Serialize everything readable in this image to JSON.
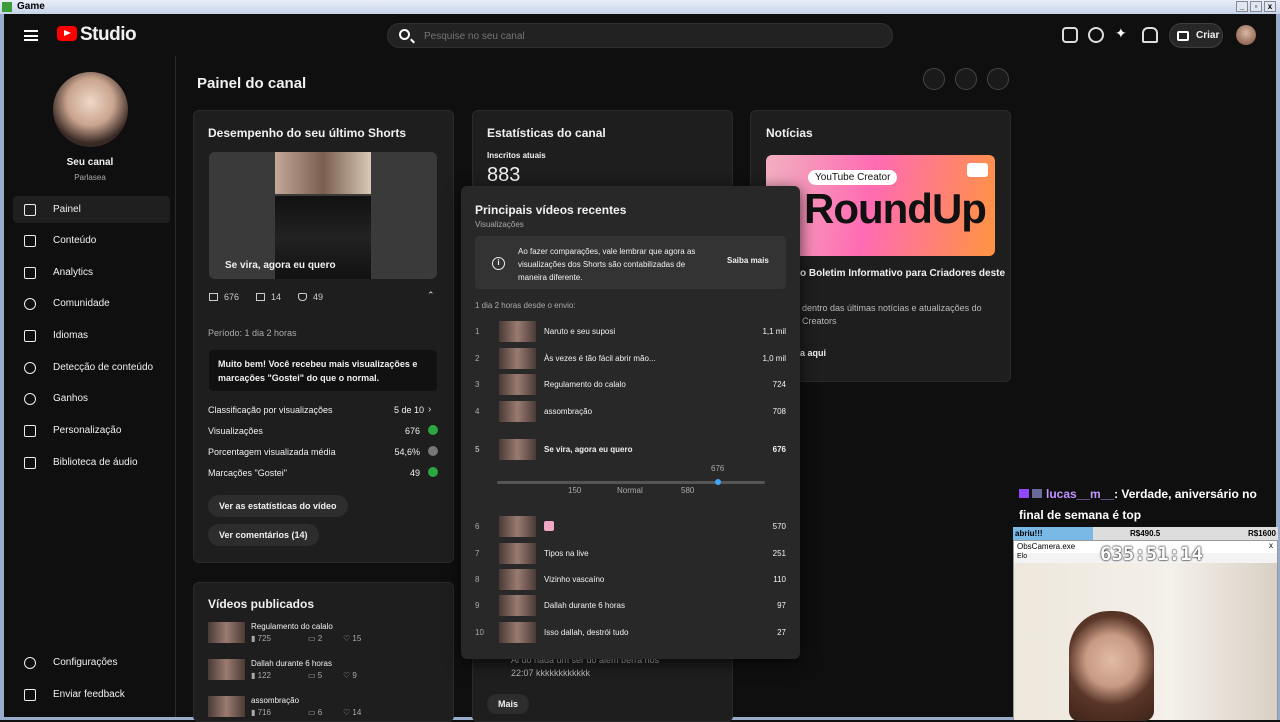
{
  "window": {
    "title": "Game"
  },
  "header": {
    "app": "Studio",
    "search_placeholder": "Pesquise no seu canal",
    "create": "Criar"
  },
  "sidebar": {
    "channel_name": "Seu canal",
    "channel_handle": "Parlasea",
    "items": [
      {
        "label": "Painel"
      },
      {
        "label": "Conteúdo"
      },
      {
        "label": "Analytics"
      },
      {
        "label": "Comunidade"
      },
      {
        "label": "Idiomas"
      },
      {
        "label": "Detecção de conteúdo"
      },
      {
        "label": "Ganhos"
      },
      {
        "label": "Personalização"
      },
      {
        "label": "Biblioteca de áudio"
      }
    ],
    "bottom": [
      {
        "label": "Configurações"
      },
      {
        "label": "Enviar feedback"
      }
    ]
  },
  "main": {
    "title": "Painel do canal"
  },
  "shorts_card": {
    "title": "Desempenho do seu último Shorts",
    "video_title": "Se vira, agora eu quero",
    "stats": {
      "views": "676",
      "comments": "14",
      "likes": "49"
    },
    "period": "Período: 1 dia 2 horas",
    "note": "Muito bem! Você recebeu mais visualizações e marcações \"Gostei\" do que o normal.",
    "metrics": [
      {
        "label": "Classificação por visualizações",
        "value": "5 de 10"
      },
      {
        "label": "Visualizações",
        "value": "676"
      },
      {
        "label": "Porcentagem visualizada média",
        "value": "54,6%"
      },
      {
        "label": "Marcações \"Gostei\"",
        "value": "49"
      }
    ],
    "btn_stats": "Ver as estatísticas do vídeo",
    "btn_comments": "Ver comentários (14)"
  },
  "published": {
    "title": "Vídeos publicados",
    "items": [
      {
        "title": "Regulamento do calalo",
        "views": "725",
        "comments": "2",
        "likes": "15"
      },
      {
        "title": "Dallah durante 6 horas",
        "views": "122",
        "comments": "5",
        "likes": "9"
      },
      {
        "title": "assombração",
        "views": "716",
        "comments": "6",
        "likes": "14"
      }
    ]
  },
  "stats_card": {
    "title": "Estatísticas do canal",
    "subs_label": "Inscritos atuais",
    "subs": "883",
    "comment_text": "Ai do nada um ser do alem berra nos",
    "comment_time": "22:07 kkkkkkkkkkkk",
    "more": "Mais"
  },
  "news": {
    "title": "Notícias",
    "banner_tag": "YouTube Creator",
    "banner_big": "RoundUp",
    "headline": "o Boletim Informativo para Criadores deste",
    "desc1": "dentro das últimas notícias e atualizações do",
    "desc2": "Creators",
    "link": "a aqui"
  },
  "popup": {
    "title": "Principais vídeos recentes",
    "subtitle": "Visualizações",
    "info": "Ao fazer comparações, vale lembrar que agora as visualizações dos Shorts são contabilizadas de maneira diferente.",
    "learn": "Saiba mais",
    "since": "1 dia 2 horas desde o envio:",
    "rows": [
      {
        "rank": "1",
        "title": "Naruto e seu suposi",
        "value": "1,1 mil"
      },
      {
        "rank": "2",
        "title": "Às vezes é tão fácil abrir mão...",
        "value": "1,0 mil"
      },
      {
        "rank": "3",
        "title": "Regulamento do calalo",
        "value": "724"
      },
      {
        "rank": "4",
        "title": "assombração",
        "value": "708"
      },
      {
        "rank": "5",
        "title": "Se vira, agora eu quero",
        "value": "676"
      },
      {
        "rank": "6",
        "title": "",
        "value": "570"
      },
      {
        "rank": "7",
        "title": "Tipos na live",
        "value": "251"
      },
      {
        "rank": "8",
        "title": "Vizinho vascaíno",
        "value": "110"
      },
      {
        "rank": "9",
        "title": "Dallah durante 6 horas",
        "value": "97"
      },
      {
        "rank": "10",
        "title": "Isso dallah, destrói tudo",
        "value": "27"
      }
    ],
    "scale": {
      "current": "676",
      "low": "150",
      "mid": "Normal",
      "high": "580"
    }
  },
  "stream": {
    "chat_user": "lucas__m__",
    "chat_text": ": Verdade, aniversário no final de semana é top",
    "bar_left": "abriu!!!",
    "bar_mid": "R$490.5",
    "bar_right": "R$1600",
    "progress_fraction": 0.3,
    "cam_title": "ObsCamera.exe",
    "cam_sub": "Elo",
    "timer": "635:51:14"
  },
  "colors": {
    "accent_red": "#ff0000",
    "good_green": "#2ba640",
    "link_blue": "#3ea6ff"
  }
}
